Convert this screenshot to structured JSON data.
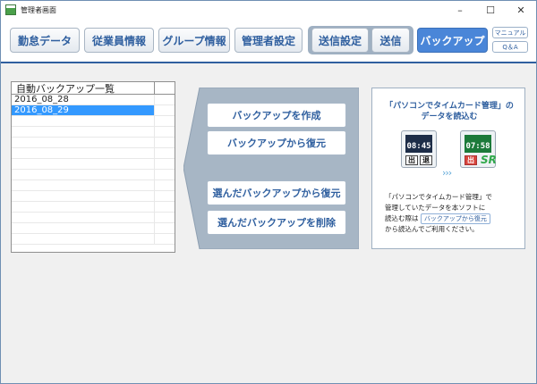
{
  "window": {
    "title": "管理者画面",
    "controls": {
      "minimize": "–",
      "maximize": "☐",
      "close": "✕"
    }
  },
  "toolbar": {
    "buttons": [
      {
        "label": "勤怠データ"
      },
      {
        "label": "従業員情報"
      },
      {
        "label": "グループ情報"
      },
      {
        "label": "管理者設定"
      },
      {
        "label": "送信設定"
      },
      {
        "label": "送信"
      },
      {
        "label": "バックアップ",
        "active": true
      }
    ],
    "manual_label": "マニュアル",
    "qa_label": "Q＆A"
  },
  "backup_list": {
    "header": "自動バックアップ一覧",
    "items": [
      {
        "label": "2016_08_28",
        "selected": false
      },
      {
        "label": "2016_08_29",
        "selected": true
      }
    ]
  },
  "actions": {
    "create": "バックアップを作成",
    "restore": "バックアップから復元",
    "restore_selected": "選んだバックアップから復元",
    "delete_selected": "選んだバックアップを削除"
  },
  "info": {
    "title_line1": "「パソコンでタイムカード管理」の",
    "title_line2": "データを読込む",
    "device_old": {
      "time": "08:45",
      "key_in": "出",
      "key_out": "退"
    },
    "device_new": {
      "time": "07:58",
      "key": "出",
      "badge": "SR"
    },
    "text_line1": "「パソコンでタイムカード管理」で",
    "text_line2": "管理していたデータを本ソフトに",
    "text_line3_prefix": "読込む際は",
    "text_line3_button": "バックアップから復元",
    "text_line4": "から読込んでご利用ください。"
  },
  "colors": {
    "accent": "#2f5f9f",
    "active_tab": "#4a86d8",
    "selection": "#3399ff",
    "panel": "#a7b6c5"
  }
}
